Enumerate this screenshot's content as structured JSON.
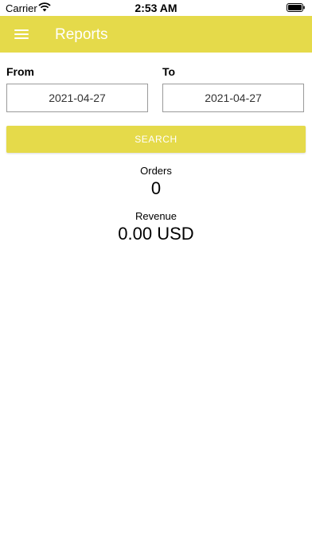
{
  "status_bar": {
    "carrier": "Carrier",
    "time": "2:53 AM"
  },
  "app_bar": {
    "title": "Reports",
    "color": "#e5da4a"
  },
  "filters": {
    "from_label": "From",
    "from_value": "2021-04-27",
    "to_label": "To",
    "to_value": "2021-04-27"
  },
  "search_button": {
    "label": "SEARCH"
  },
  "stats": {
    "orders_label": "Orders",
    "orders_value": "0",
    "revenue_label": "Revenue",
    "revenue_value": "0.00 USD"
  }
}
